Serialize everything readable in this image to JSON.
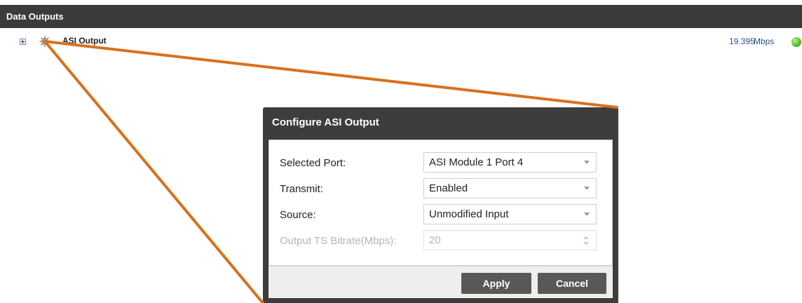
{
  "section": {
    "title": "Data Outputs"
  },
  "output_row": {
    "expand_icon": "plus-box-icon",
    "settings_icon": "gear-icon",
    "label": "ASI Output",
    "bitrate_value": "19.395",
    "bitrate_unit": "Mbps",
    "status_color": "#52c42a"
  },
  "dialog": {
    "title": "Configure ASI Output",
    "fields": [
      {
        "label": "Selected Port:",
        "value": "ASI Module 1 Port 4"
      },
      {
        "label": "Transmit:",
        "value": "Enabled"
      },
      {
        "label": "Source:",
        "value": "Unmodified Input"
      },
      {
        "label": "Output TS Bitrate(Mbps):",
        "value": "20"
      }
    ],
    "apply_label": "Apply",
    "cancel_label": "Cancel"
  },
  "colors": {
    "header_bg": "#3d3b39",
    "dialog_bg": "#3f3d3b",
    "annotation_line": "#d9701c",
    "button_bg": "#5a5856"
  }
}
